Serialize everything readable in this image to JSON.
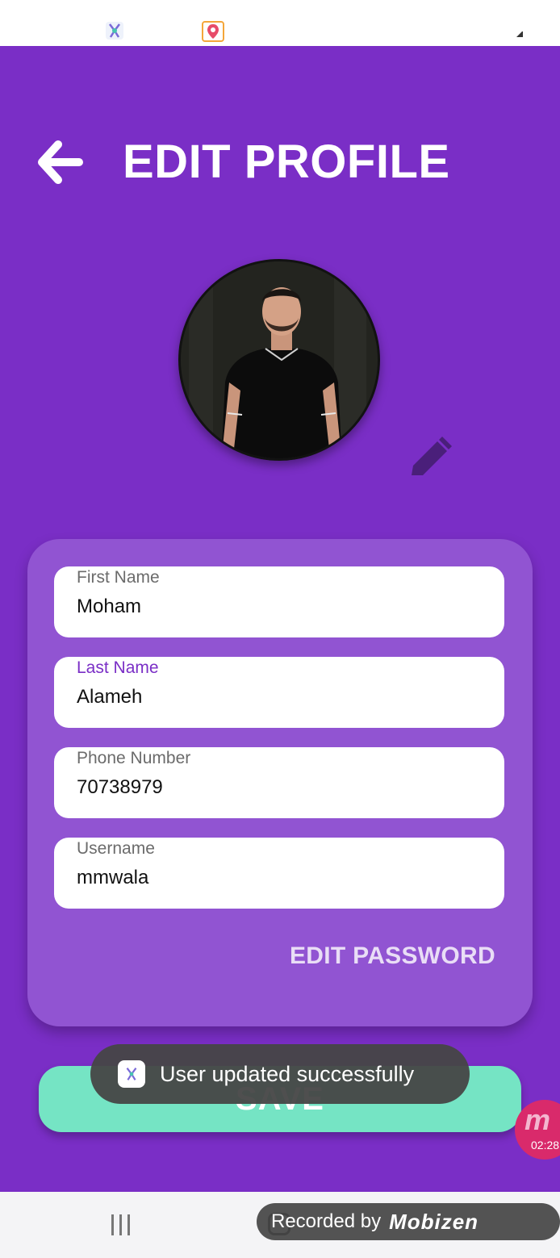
{
  "header": {
    "title": "EDIT PROFILE"
  },
  "form": {
    "first_name": {
      "label": "First Name",
      "value": "Moham"
    },
    "last_name": {
      "label": "Last Name",
      "value": "Alameh"
    },
    "phone": {
      "label": "Phone Number",
      "value": "70738979"
    },
    "username": {
      "label": "Username",
      "value": "mmwala"
    },
    "edit_password": "EDIT PASSWORD"
  },
  "save_label": "SAVE",
  "toast": {
    "message": "User updated successfully"
  },
  "recorder": {
    "timer": "02:28",
    "watermark_prefix": "Recorded by",
    "watermark_brand": "Mobizen"
  },
  "colors": {
    "primary": "#7a2ec6",
    "card": "#9154d2",
    "save": "#75e4c4",
    "toast": "#464646"
  }
}
